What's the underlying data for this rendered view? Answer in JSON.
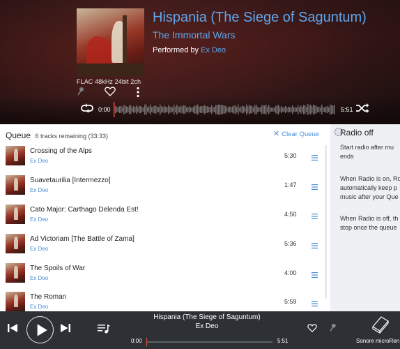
{
  "now_playing": {
    "title": "Hispania (The Siege of Saguntum)",
    "album": "The Immortal Wars",
    "performed_by_label": "Performed by",
    "artist": "Ex Deo",
    "format": "FLAC 48kHz 24bit 2ch",
    "time_elapsed": "0:00",
    "time_total": "5:51",
    "progress": 0.0
  },
  "queue": {
    "title": "Queue",
    "subtitle": "6 tracks remaining (33:33)",
    "clear_label": "Clear Queue",
    "tracks": [
      {
        "name": "Crossing of the Alps",
        "artist": "Ex Deo",
        "duration": "5:30"
      },
      {
        "name": "Suavetaurilia [Intermezzo]",
        "artist": "Ex Deo",
        "duration": "1:47"
      },
      {
        "name": "Cato Major: Carthago Delenda Est!",
        "artist": "Ex Deo",
        "duration": "4:50"
      },
      {
        "name": "Ad Victoriam [The Battle of Zama]",
        "artist": "Ex Deo",
        "duration": "5:36"
      },
      {
        "name": "The Spoils of War",
        "artist": "Ex Deo",
        "duration": "4:00"
      },
      {
        "name": "The Roman",
        "artist": "Ex Deo",
        "duration": "5:59"
      }
    ]
  },
  "radio": {
    "title": "Radio off",
    "p1_line1": "Start radio after mu",
    "p1_line2": "ends",
    "p2_line1": "When Radio is on, Ro",
    "p2_line2": "automatically keep p",
    "p2_line3": "music after your Que",
    "p3_line1": "When Radio is off, th",
    "p3_line2": "stop once the queue"
  },
  "player": {
    "title": "Hispania (The Siege of Saguntum)",
    "artist": "Ex Deo",
    "time_elapsed": "0:00",
    "time_total": "5:51",
    "device_label": "Sonore microRen"
  },
  "colors": {
    "accent_blue": "#5fa6ec",
    "link_blue": "#4a90d9",
    "player_bg": "#2d3136",
    "progress_head": "#e0503c"
  },
  "icons": {
    "mic": "mic-icon",
    "heart": "heart-icon",
    "more": "more-vert-icon",
    "repeat": "repeat-icon",
    "shuffle": "shuffle-icon",
    "close": "close-icon",
    "menu": "hamburger-icon",
    "prev": "skip-previous-icon",
    "play": "play-icon",
    "next": "skip-next-icon",
    "queue": "queue-music-icon",
    "device": "device-icon"
  }
}
